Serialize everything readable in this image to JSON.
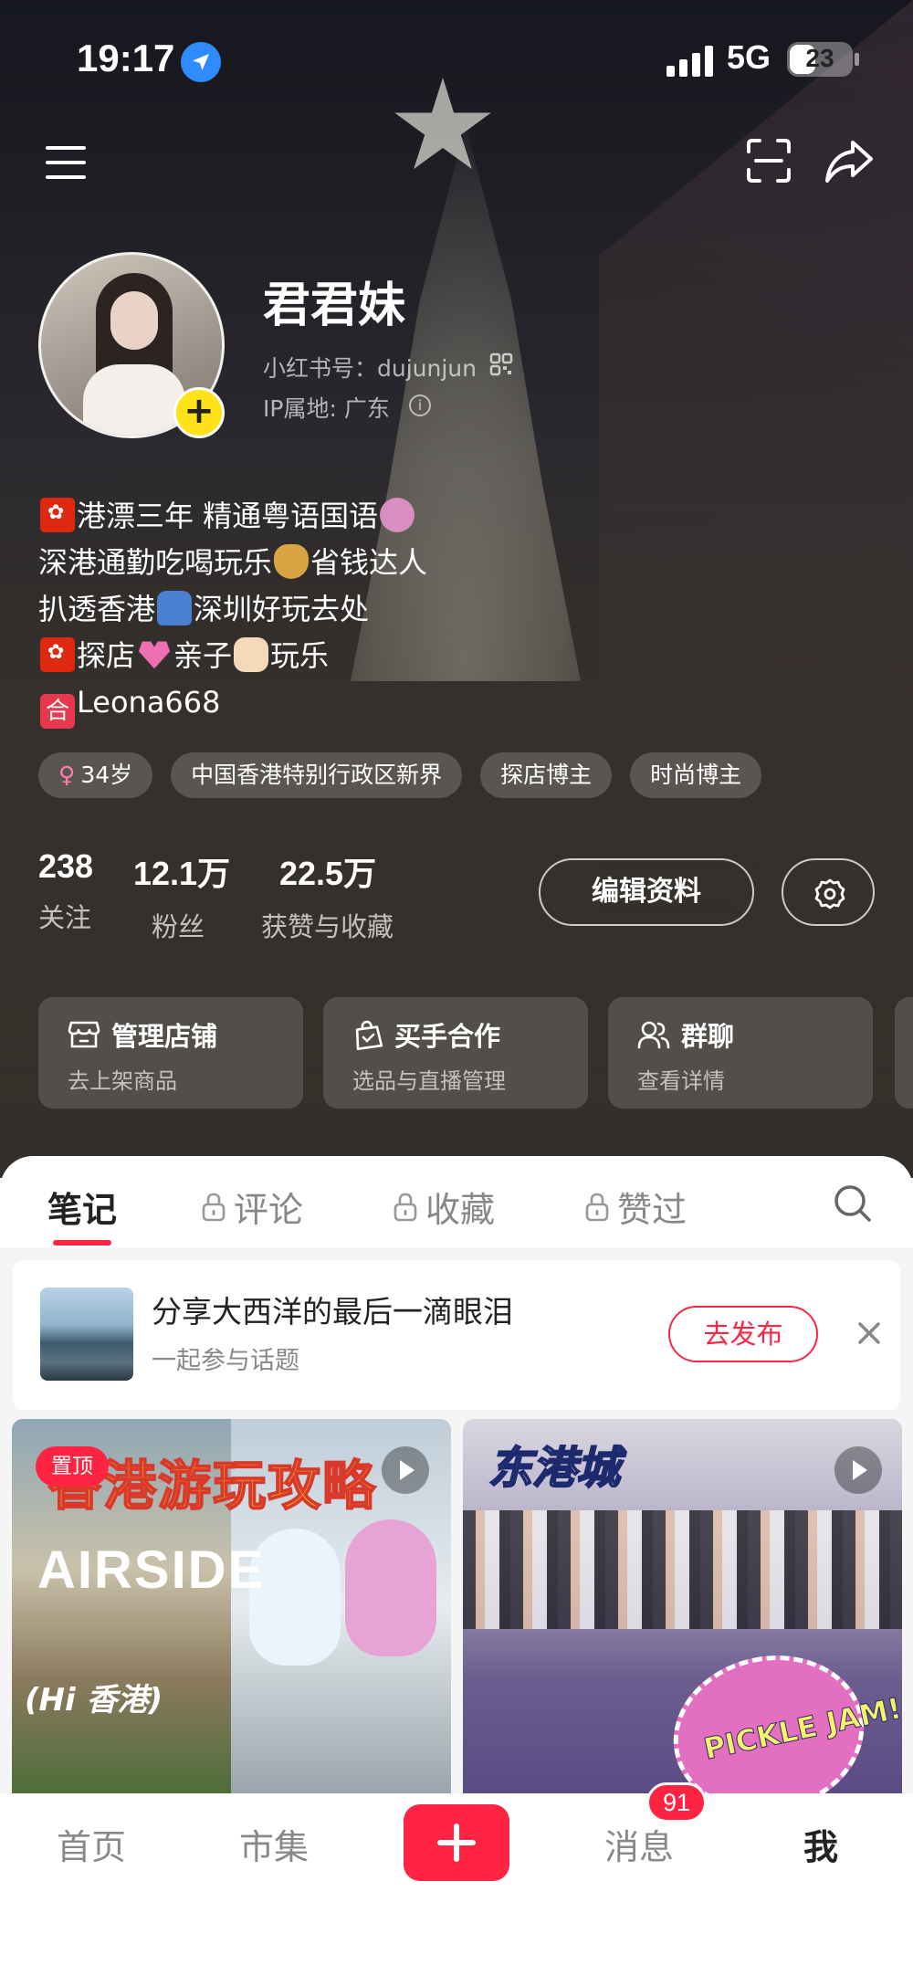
{
  "status_bar": {
    "time": "19:17",
    "network": "5G",
    "battery": "23",
    "icons": [
      "location-arrow-icon",
      "signal-icon",
      "battery-icon"
    ]
  },
  "top_nav": {
    "icons": [
      "menu-icon",
      "scan-icon",
      "share-icon"
    ]
  },
  "profile": {
    "nickname": "君君妹",
    "red_id": "小红书号：dujunjun",
    "ip_location": "IP属地: 广东",
    "avatar_add": "+",
    "bio_lines": [
      "港漂三年 精通粤语国语",
      "深港通勤吃喝玩乐",
      "省钱达人",
      "扒透香港",
      "深圳好玩去处",
      "探店",
      "亲子",
      "玩乐",
      "Leona668"
    ],
    "bio_emoji": [
      "hk-flag",
      "woman-gesture",
      "money-bag",
      "car",
      "hk-flag",
      "two-hearts",
      "rock-hand",
      "he-sign"
    ],
    "he_char": "合",
    "tags": [
      "34岁",
      "中国香港特别行政区新界",
      "探店博主",
      "时尚博主"
    ],
    "gender_symbol": "♀"
  },
  "stats": [
    {
      "value": "238",
      "label": "关注"
    },
    {
      "value": "12.1万",
      "label": "粉丝"
    },
    {
      "value": "22.5万",
      "label": "获赞与收藏"
    }
  ],
  "actions": {
    "edit_profile": "编辑资料"
  },
  "service_cards": [
    {
      "title": "管理店铺",
      "subtitle": "去上架商品",
      "icon": "store-icon"
    },
    {
      "title": "买手合作",
      "subtitle": "选品与直播管理",
      "icon": "bag-icon"
    },
    {
      "title": "群聊",
      "subtitle": "查看详情",
      "icon": "group-icon"
    }
  ],
  "tabs": [
    {
      "label": "笔记",
      "locked": false,
      "active": true
    },
    {
      "label": "评论",
      "locked": true,
      "active": false
    },
    {
      "label": "收藏",
      "locked": true,
      "active": false
    },
    {
      "label": "赞过",
      "locked": true,
      "active": false
    }
  ],
  "topic": {
    "title": "分享大西洋的最后一滴眼泪",
    "subtitle": "一起参与话题",
    "button": "去发布"
  },
  "notes": [
    {
      "badge": "置顶",
      "cover_title": "香港游玩攻略",
      "cover_text_1": "AIRSIDE",
      "cover_text_2": "(Hi 香港)"
    },
    {
      "cover_title": "东港城",
      "cover_text_1": "PICKLE JAM!"
    }
  ],
  "bottom_nav": [
    {
      "label": "首页",
      "active": false
    },
    {
      "label": "市集",
      "active": false
    },
    {
      "label": "消息",
      "active": false,
      "badge": "91"
    },
    {
      "label": "我",
      "active": true
    }
  ],
  "colors": {
    "accent": "#ff2442",
    "avatar_add": "#ffe21a",
    "location": "#2f8cff"
  }
}
